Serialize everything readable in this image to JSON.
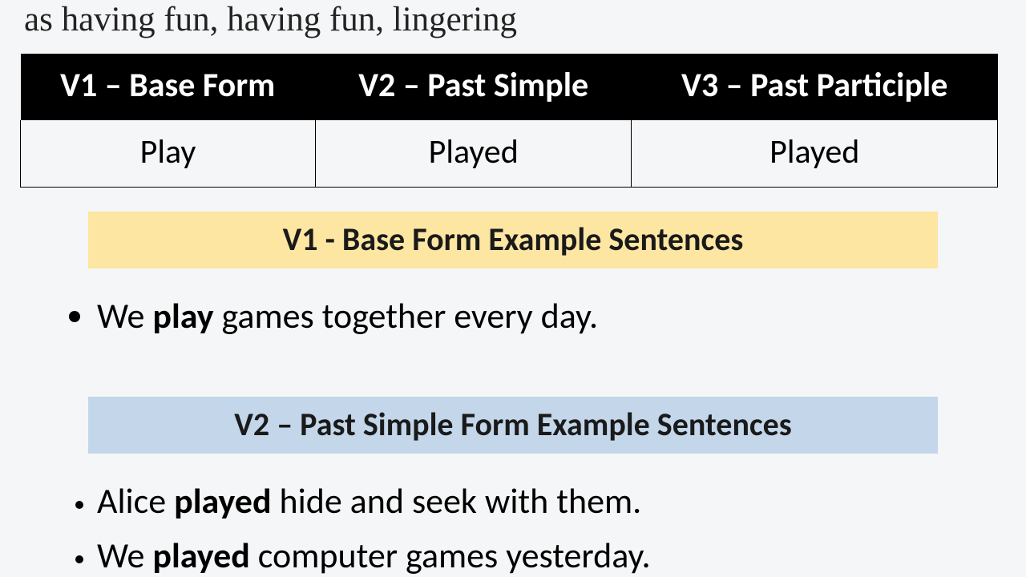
{
  "intro_text": "as having fun, having fun, lingering",
  "table": {
    "h1": "V1 – Base Form",
    "h2": "V2 – Past Simple",
    "h3": "V3 – Past Participle",
    "v1": "Play",
    "v2": "Played",
    "v3": "Played"
  },
  "section1": {
    "heading": "V1 - Base Form Example Sentences",
    "ex1_pre": "We ",
    "ex1_bold": "play",
    "ex1_post": " games together every day."
  },
  "section2": {
    "heading": "V2 – Past Simple Form Example Sentences",
    "ex1_pre": "Alice ",
    "ex1_bold": "played",
    "ex1_post": " hide and seek with them.",
    "ex2_pre": "We ",
    "ex2_bold": "played",
    "ex2_post": " computer games yesterday."
  }
}
